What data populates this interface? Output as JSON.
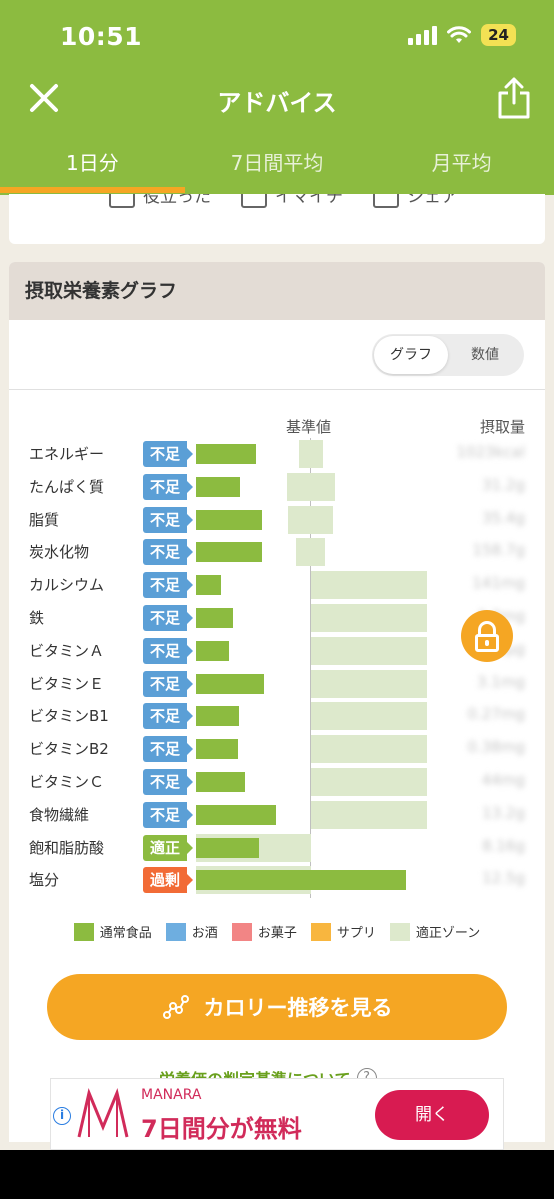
{
  "status": {
    "time": "10:51",
    "battery": "24"
  },
  "nav": {
    "title": "アドバイス"
  },
  "tabs": [
    {
      "label": "1日分"
    },
    {
      "label": "7日間平均"
    },
    {
      "label": "月平均"
    }
  ],
  "top_card": {
    "actions": [
      "役立った",
      "イマイチ",
      "シェア"
    ]
  },
  "section": {
    "title": "摂取栄養素グラフ",
    "toggle": {
      "graph": "グラフ",
      "numeric": "数値",
      "selected": "グラフ"
    },
    "col_reference": "基準値",
    "col_intake": "摂取量"
  },
  "chart_data": {
    "type": "bar",
    "rows": [
      {
        "name": "エネルギー",
        "status": "不足",
        "value": "1023kcal",
        "bar": 0.56
      },
      {
        "name": "たんぱく質",
        "status": "不足",
        "value": "31.2g",
        "bar": 0.41
      },
      {
        "name": "脂質",
        "status": "不足",
        "value": "35.4g",
        "bar": 0.61
      },
      {
        "name": "炭水化物",
        "status": "不足",
        "value": "158.7g",
        "bar": 0.61
      },
      {
        "name": "カルシウム",
        "status": "不足",
        "value": "141mg",
        "bar": 0.23
      },
      {
        "name": "鉄",
        "status": "不足",
        "value": "3.3mg",
        "bar": 0.34
      },
      {
        "name": "ビタミンＡ",
        "status": "不足",
        "value": "190µg",
        "bar": 0.31
      },
      {
        "name": "ビタミンＥ",
        "status": "不足",
        "value": "3.1mg",
        "bar": 0.63
      },
      {
        "name": "ビタミンB1",
        "status": "不足",
        "value": "0.27mg",
        "bar": 0.4
      },
      {
        "name": "ビタミンB2",
        "status": "不足",
        "value": "0.38mg",
        "bar": 0.39
      },
      {
        "name": "ビタミンＣ",
        "status": "不足",
        "value": "44mg",
        "bar": 0.45
      },
      {
        "name": "食物繊維",
        "status": "不足",
        "value": "13.2g",
        "bar": 0.74
      },
      {
        "name": "飽和脂肪酸",
        "status": "適正",
        "value": "8.16g",
        "bar": 0.58
      },
      {
        "name": "塩分",
        "status": "過剰",
        "value": "12.5g",
        "bar": 1.94
      }
    ],
    "status_colors": {
      "不足": "#5b9fd6",
      "適正": "#8cbb40",
      "過剰": "#f26b36"
    },
    "legend": [
      {
        "label": "通常食品",
        "color": "#8cbb40"
      },
      {
        "label": "お酒",
        "color": "#6eaee0"
      },
      {
        "label": "お菓子",
        "color": "#f28585"
      },
      {
        "label": "サプリ",
        "color": "#f8b63f"
      },
      {
        "label": "適正ゾーン",
        "color": "#dde9cc"
      }
    ]
  },
  "cta": {
    "label": "カロリー推移を見る"
  },
  "criteria": {
    "label": "栄養価の判定基準について",
    "help": "?"
  },
  "ad": {
    "brand": "MANARA",
    "headline": "7日間分が無料",
    "button": "開く",
    "info": "i"
  }
}
